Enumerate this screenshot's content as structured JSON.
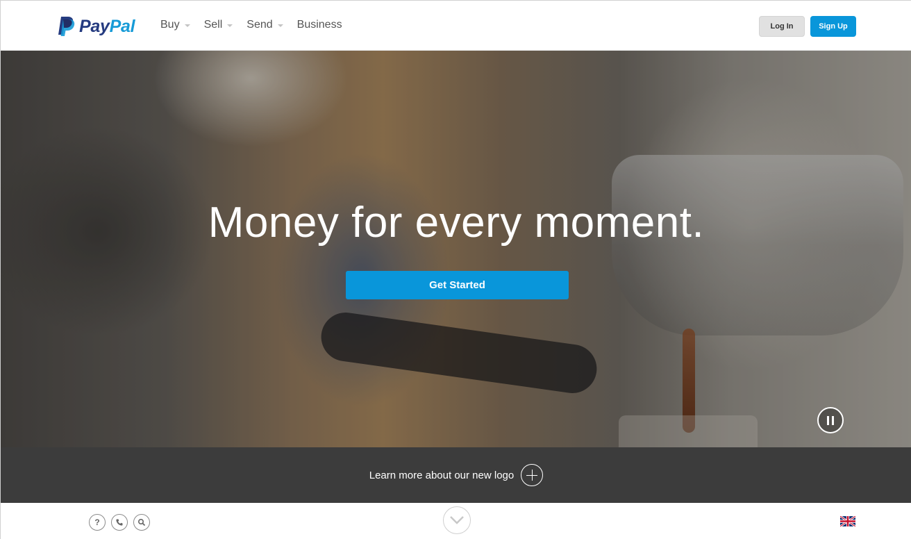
{
  "brand": {
    "logo_pay": "Pay",
    "logo_pal": "Pal",
    "primary_color": "#0996da",
    "dark_blue": "#253b80",
    "light_blue": "#179bd7"
  },
  "nav": {
    "items": [
      {
        "label": "Buy",
        "has_dropdown": true
      },
      {
        "label": "Sell",
        "has_dropdown": true
      },
      {
        "label": "Send",
        "has_dropdown": true
      },
      {
        "label": "Business",
        "has_dropdown": false
      }
    ],
    "login_label": "Log In",
    "signup_label": "Sign Up"
  },
  "hero": {
    "headline": "Money for every moment.",
    "cta_label": "Get Started",
    "video_control": "pause-icon"
  },
  "logo_band": {
    "text": "Learn more about our new logo",
    "icon": "plus-circle-icon"
  },
  "footer": {
    "icons": [
      "help-icon",
      "phone-icon",
      "search-icon"
    ],
    "help_glyph": "?",
    "scroll_icon": "chevron-down-icon",
    "language_flag": "uk-flag-icon"
  }
}
